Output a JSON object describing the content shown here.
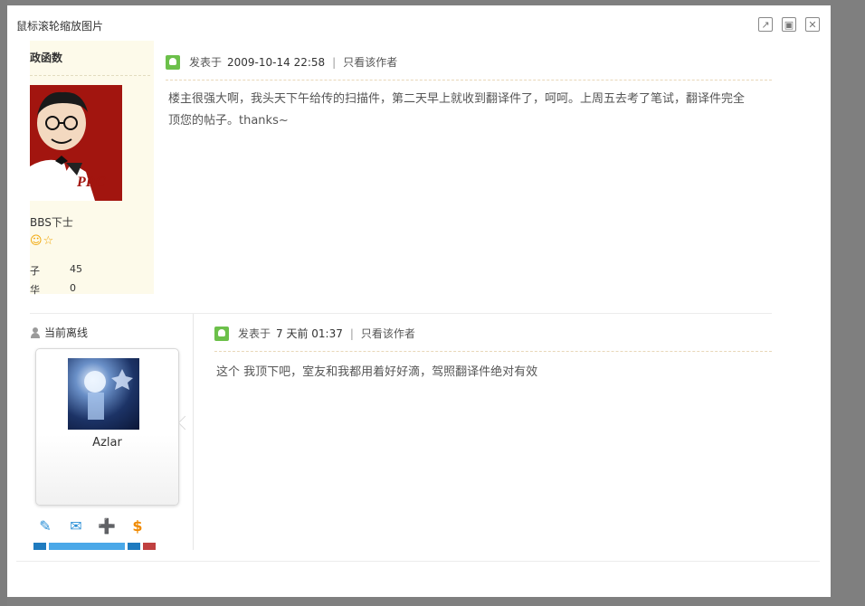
{
  "window": {
    "title": "鼠标滚轮缩放图片",
    "buttons": {
      "open": "↗",
      "maximize": "▣",
      "close": "✕"
    }
  },
  "post1": {
    "side_heading": "政函数",
    "avatar_text": "PRC",
    "rank": "BBS下士",
    "stars": "☺☆",
    "stats": [
      {
        "label": "子",
        "value": "45"
      },
      {
        "label": "华",
        "value": "0"
      }
    ],
    "posted_prefix": "发表于",
    "date": "2009-10-14 22:58",
    "separator": "|",
    "only_author": "只看该作者",
    "body_line1": "楼主很强大啊，我头天下午给传的扫描件，第二天早上就收到翻译件了，呵呵。上周五去考了笔试，翻译件完全",
    "body_line2": "顶您的帖子。thanks~"
  },
  "post2": {
    "status": "当前离线",
    "username": "Azlar",
    "posted_prefix": "发表于",
    "date": "7 天前 01:37",
    "separator": "|",
    "only_author": "只看该作者",
    "body": "这个  我顶下吧，室友和我都用着好好滴，驾照翻译件绝对有效",
    "action_icons": [
      "✎",
      "✉",
      "➕",
      "$"
    ]
  }
}
